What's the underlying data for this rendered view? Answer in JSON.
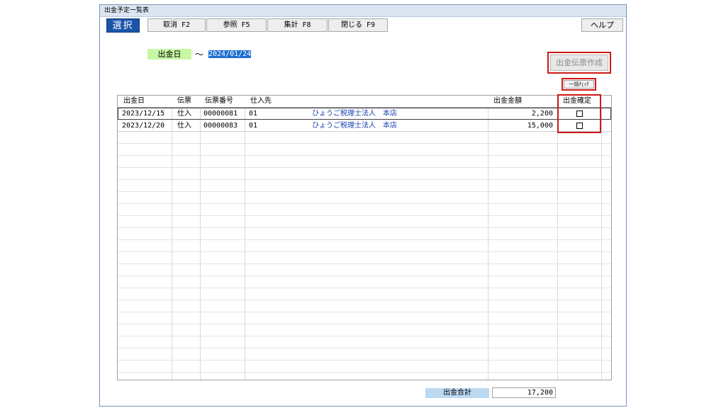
{
  "window": {
    "title": "出金予定一覧表"
  },
  "toolbar": {
    "select_label": "選択",
    "buttons": [
      "取消 F2",
      "参照 F5",
      "集計 F8",
      "閉じる F9"
    ],
    "help_label": "ヘルプ"
  },
  "filter": {
    "date_label": "出金日",
    "tilde": "～",
    "date_value": "2024/01/24"
  },
  "actions": {
    "create_voucher_label": "出金伝票作成",
    "bulk_check_label": "一括ﾁｪｯｸ"
  },
  "table": {
    "headers": {
      "date": "出金日",
      "voucher": "伝票",
      "voucher_no": "伝票番号",
      "supplier": "仕入先",
      "amount": "出金金額",
      "confirm": "出金確定"
    },
    "rows": [
      {
        "date": "2023/12/15",
        "voucher": "仕入",
        "voucher_no": "00000081",
        "supplier_code": "01",
        "supplier_name": "ひょうご税理士法人　本店",
        "amount": "2,200",
        "confirmed": false
      },
      {
        "date": "2023/12/20",
        "voucher": "仕入",
        "voucher_no": "00000083",
        "supplier_code": "01",
        "supplier_name": "ひょうご税理士法人　本店",
        "amount": "15,000",
        "confirmed": false
      }
    ]
  },
  "footer": {
    "total_label": "出金合計",
    "total_value": "17,200"
  },
  "colors": {
    "select_bg": "#1a56a8",
    "date_label_bg": "#c8f7a4",
    "total_label_bg": "#bcd9f2",
    "highlight_red": "#d01818",
    "supplier_text": "#1a3fb0"
  }
}
